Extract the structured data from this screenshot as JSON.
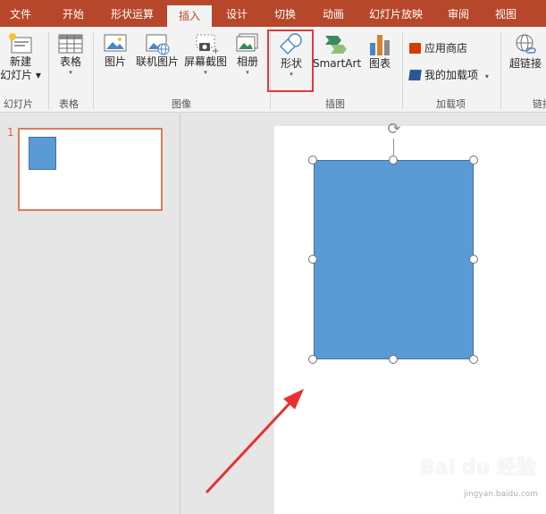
{
  "ribbon_tabs": [
    {
      "label": "文件"
    },
    {
      "label": "开始"
    },
    {
      "label": "形状运算"
    },
    {
      "label": "插入"
    },
    {
      "label": "设计"
    },
    {
      "label": "切换"
    },
    {
      "label": "动画"
    },
    {
      "label": "幻灯片放映"
    },
    {
      "label": "审阅"
    },
    {
      "label": "视图"
    }
  ],
  "active_tab": "插入",
  "colors": {
    "tab_bar": "#b7472a",
    "ribbon_bg": "#f3f3f3",
    "shape_fill": "#5b9bd5",
    "shape_border": "#41719c",
    "highlight": "#e03a3a",
    "thumb_border": "#e07a5a"
  },
  "ribbon": {
    "new_slide": {
      "line1": "新建",
      "line2": "幻灯片",
      "icon": "new-slide-icon"
    },
    "table": {
      "label": "表格",
      "icon": "table-icon"
    },
    "picture": {
      "label": "图片",
      "icon": "picture-icon"
    },
    "online_picture": {
      "label": "联机图片",
      "icon": "online-picture-icon"
    },
    "screenshot": {
      "label": "屏幕截图",
      "icon": "screenshot-icon"
    },
    "album": {
      "label": "相册",
      "icon": "photo-album-icon"
    },
    "shapes": {
      "label": "形状",
      "icon": "shapes-icon"
    },
    "smartart": {
      "label": "SmartArt",
      "icon": "smartart-icon"
    },
    "chart": {
      "label": "图表",
      "icon": "chart-icon"
    },
    "store": {
      "label": "应用商店",
      "icon": "store-icon"
    },
    "my_addins": {
      "label": "我的加载项",
      "icon": "addins-icon"
    },
    "hyperlink": {
      "label": "超链接",
      "icon": "hyperlink-icon"
    },
    "groups": {
      "slides": "幻灯片",
      "tables": "表格",
      "images": "图像",
      "illustrations": "插图",
      "addins": "加载项",
      "links": "链接"
    }
  },
  "thumbnails": [
    {
      "number": "1"
    }
  ],
  "watermark": {
    "text": "Bai du 经验",
    "sub": "jingyan.baidu.com"
  }
}
